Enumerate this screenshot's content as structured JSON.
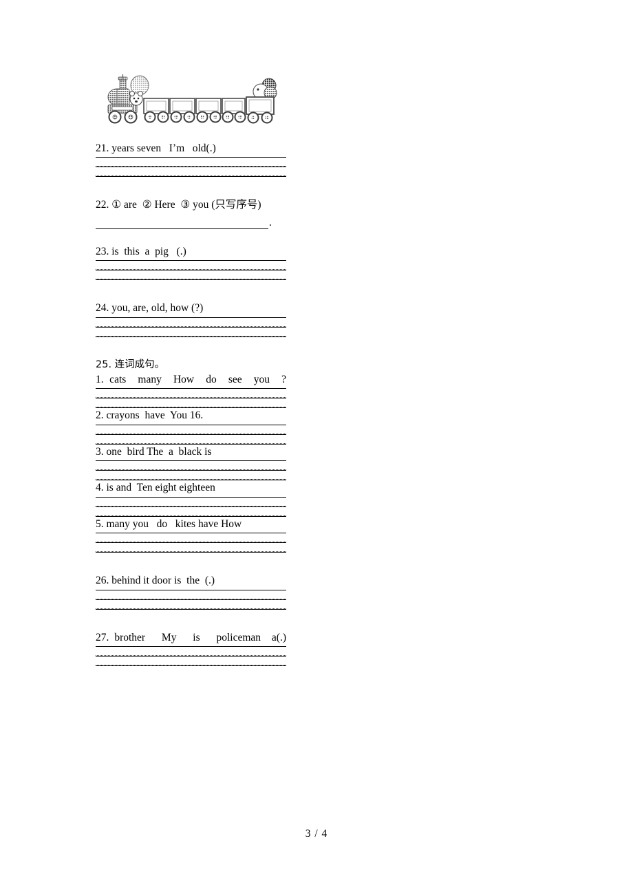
{
  "page": {
    "footer": "3 / 4"
  },
  "figure": {
    "name": "train-clipart",
    "description": "toy train with bear, balloons and five wagons"
  },
  "questions": [
    {
      "id": "q21",
      "text": "21. years seven   I’m   old(.)",
      "answer_style": "ruled",
      "rule_lines": 3
    },
    {
      "id": "q22",
      "text": "22. ① are  ② Here  ③ you (只写序号)",
      "answer_style": "single-underline",
      "trailing": "."
    },
    {
      "id": "q23",
      "text": "23. is  this  a  pig   (.)",
      "answer_style": "ruled",
      "rule_lines": 3
    },
    {
      "id": "q24",
      "text": "24. you, are, old, how (?)",
      "answer_style": "ruled",
      "rule_lines": 3
    },
    {
      "id": "q25",
      "heading": "25. 连词成句。",
      "answer_style": "subitems",
      "subitems": [
        {
          "id": "q25-1",
          "text": "1. cats  many  How  do  see  you  ?",
          "rule_lines": 3
        },
        {
          "id": "q25-2",
          "text": "2. crayons  have  You 16.",
          "rule_lines": 3
        },
        {
          "id": "q25-3",
          "text": "3. one  bird The  a  black is",
          "rule_lines": 3
        },
        {
          "id": "q25-4",
          "text": "4. is and  Ten eight eighteen",
          "rule_lines": 3
        },
        {
          "id": "q25-5",
          "text": "5. many you   do   kites have How",
          "rule_lines": 3
        }
      ]
    },
    {
      "id": "q26",
      "text": "26. behind it door is  the  (.)",
      "answer_style": "ruled",
      "rule_lines": 3
    },
    {
      "id": "q27",
      "text": "27. brother   My   is   policeman  a(.)",
      "answer_style": "ruled",
      "rule_lines": 3,
      "justified": true
    }
  ]
}
